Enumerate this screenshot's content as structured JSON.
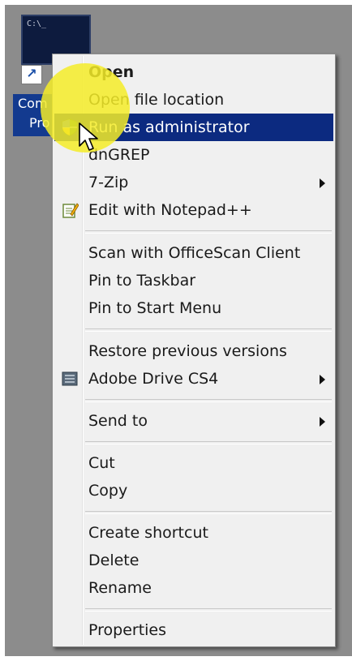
{
  "shortcut": {
    "prompt": "C:\\_",
    "label_line1": "Com",
    "label_line2": "Pro"
  },
  "context_menu": {
    "items": [
      {
        "label": "Open",
        "bold": true
      },
      {
        "label": "Open file location"
      },
      {
        "label": "Run as administrator",
        "highlighted": true,
        "icon": "uac-shield-icon"
      },
      {
        "label": "dnGREP"
      },
      {
        "label": "7-Zip",
        "submenu": true
      },
      {
        "label": "Edit with Notepad++",
        "icon": "notepad-plus-plus-icon"
      },
      {
        "label": "Scan with OfficeScan Client"
      },
      {
        "label": "Pin to Taskbar"
      },
      {
        "label": "Pin to Start Menu"
      },
      {
        "label": "Restore previous versions"
      },
      {
        "label": "Adobe Drive CS4",
        "submenu": true,
        "icon": "adobe-drive-icon"
      },
      {
        "label": "Send to",
        "submenu": true
      },
      {
        "label": "Cut"
      },
      {
        "label": "Copy"
      },
      {
        "label": "Create shortcut"
      },
      {
        "label": "Delete"
      },
      {
        "label": "Rename"
      },
      {
        "label": "Properties"
      }
    ]
  },
  "colors": {
    "highlight": "#0c2a80",
    "desktop": "#8c8c8c",
    "menu_background": "#f0f0f0",
    "cursor_halo": "#f4ec28"
  }
}
